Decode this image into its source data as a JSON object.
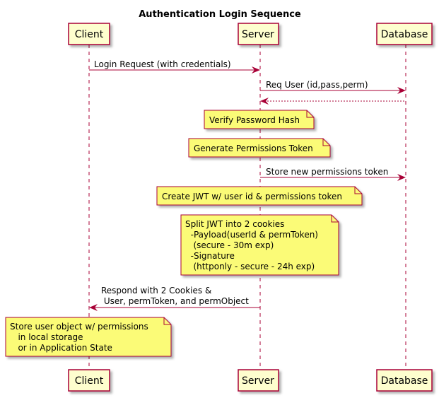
{
  "diagram": {
    "title": "Authentication Login Sequence",
    "colors": {
      "participant_fill": "#FEFECE",
      "participant_border": "#A80036",
      "note_fill": "#FBFB77",
      "note_border": "#A80036",
      "arrow": "#A80036"
    },
    "participants": [
      {
        "id": "client",
        "label": "Client"
      },
      {
        "id": "server",
        "label": "Server"
      },
      {
        "id": "database",
        "label": "Database"
      }
    ],
    "messages": [
      {
        "from": "client",
        "to": "server",
        "style": "solid",
        "lines": [
          "Login Request (with credentials)"
        ]
      },
      {
        "from": "server",
        "to": "database",
        "style": "solid",
        "lines": [
          "Req User (id,pass,perm)"
        ]
      },
      {
        "from": "database",
        "to": "server",
        "style": "dashed",
        "lines": []
      },
      {
        "from": "server",
        "to": "database",
        "style": "solid",
        "lines": [
          "Store new permissions token"
        ]
      },
      {
        "from": "server",
        "to": "client",
        "style": "solid",
        "lines": [
          "Respond with 2 Cookies &",
          " User, permToken, and permObject"
        ]
      }
    ],
    "notes": [
      {
        "over": "server",
        "lines": [
          "Verify Password Hash"
        ]
      },
      {
        "over": "server",
        "lines": [
          "Generate Permissions Token"
        ]
      },
      {
        "over": "server",
        "lines": [
          "Create JWT w/ user id & permissions token"
        ]
      },
      {
        "over": "server",
        "lines": [
          "Split JWT into 2 cookies",
          "  -Payload(userId & permToken)",
          "   (secure - 30m exp)",
          "  -Signature",
          "   (httponly - secure - 24h exp)"
        ]
      },
      {
        "over": "client",
        "lines": [
          "Store user object w/ permissions",
          "   in local storage",
          "   or in Application State"
        ]
      }
    ]
  }
}
